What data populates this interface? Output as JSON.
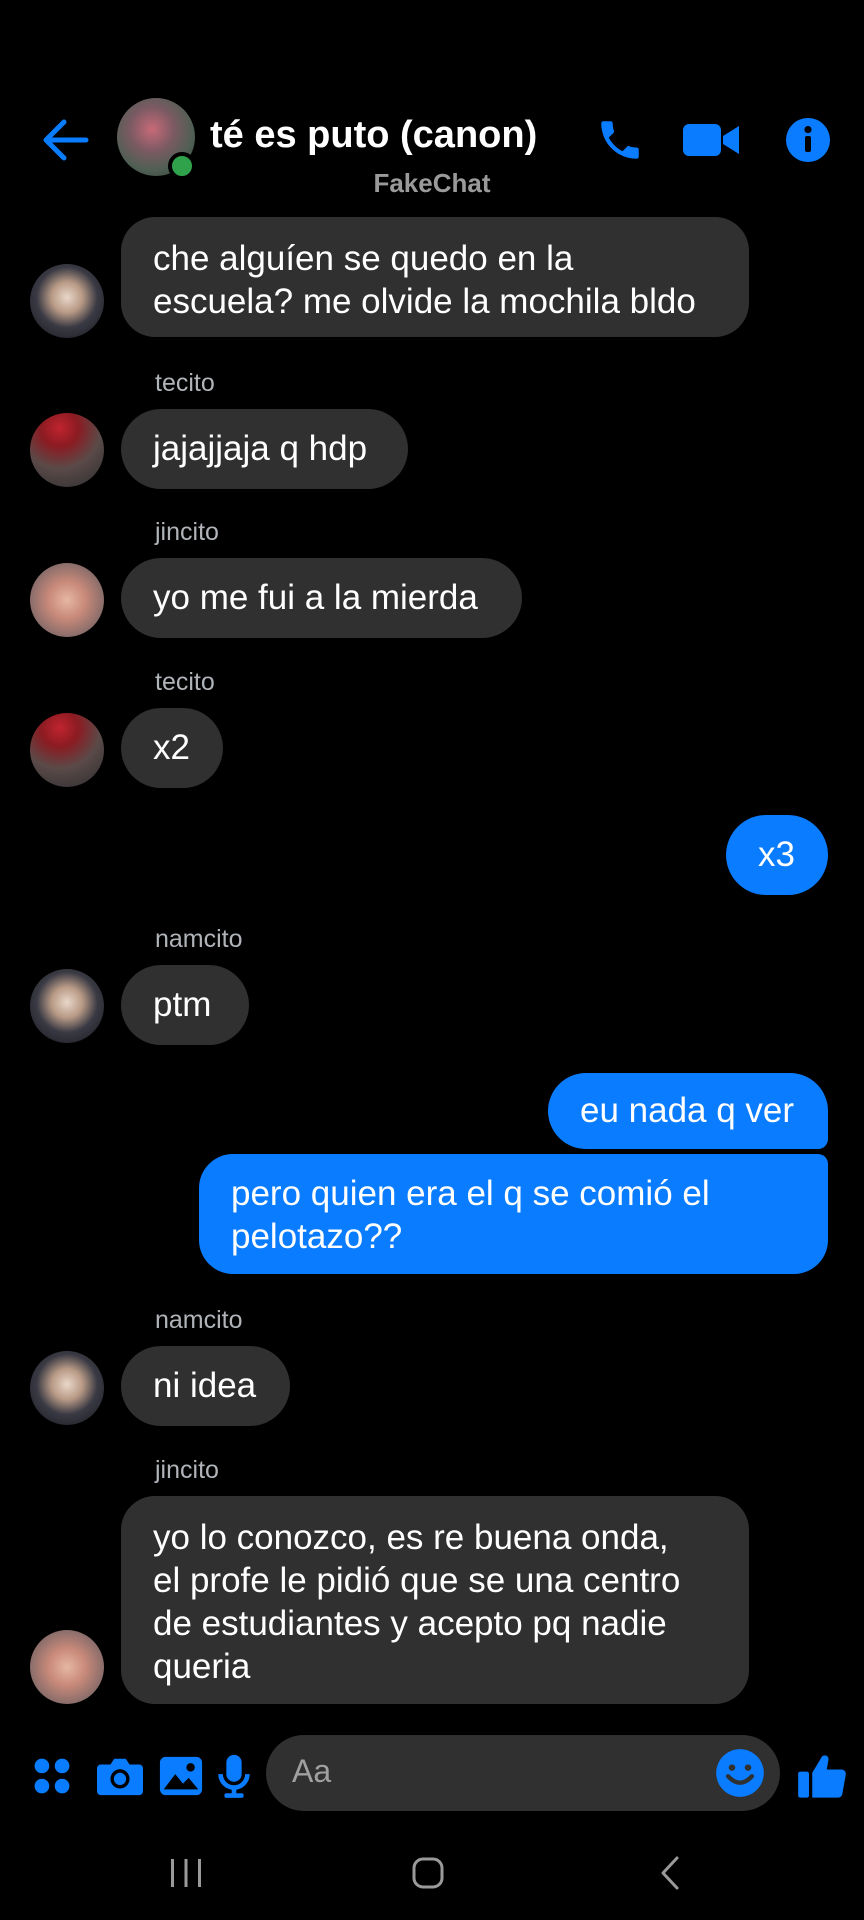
{
  "header": {
    "title": "té es puto (canon)",
    "subtitle": "FakeChat",
    "accent": "#0a7cff",
    "online_color": "#31a24c"
  },
  "messages": [
    {
      "sender": "",
      "text": "che alguíen se quedo en la\nescuela? me olvide la mochila bldo",
      "direction": "in",
      "avatar": "namcito"
    },
    {
      "sender": "tecito",
      "text": "jajajjaja q hdp",
      "direction": "in",
      "avatar": "tecito"
    },
    {
      "sender": "jincito",
      "text": "yo me fui a la mierda",
      "direction": "in",
      "avatar": "jincito"
    },
    {
      "sender": "tecito",
      "text": "x2",
      "direction": "in",
      "avatar": "tecito"
    },
    {
      "sender": "",
      "text": "x3",
      "direction": "out"
    },
    {
      "sender": "namcito",
      "text": "ptm",
      "direction": "in",
      "avatar": "namcito"
    },
    {
      "sender": "",
      "text": "eu nada q ver",
      "direction": "out"
    },
    {
      "sender": "",
      "text": "pero quien era el q se comió el\npelotazo??",
      "direction": "out"
    },
    {
      "sender": "namcito",
      "text": "ni idea",
      "direction": "in",
      "avatar": "namcito"
    },
    {
      "sender": "jincito",
      "text": "yo lo conozco, es re buena onda,\nel profe le pidió que se una centro\nde estudiantes y acepto pq nadie\nqueria",
      "direction": "in",
      "avatar": "jincito"
    }
  ],
  "composer": {
    "placeholder": "Aa",
    "icons": [
      "apps-icon",
      "camera-icon",
      "gallery-icon",
      "microphone-icon",
      "emoji-icon",
      "thumbs-up-icon"
    ]
  },
  "colors": {
    "incoming_bubble": "#303030",
    "outgoing_bubble": "#0a7cff",
    "background": "#000000"
  }
}
